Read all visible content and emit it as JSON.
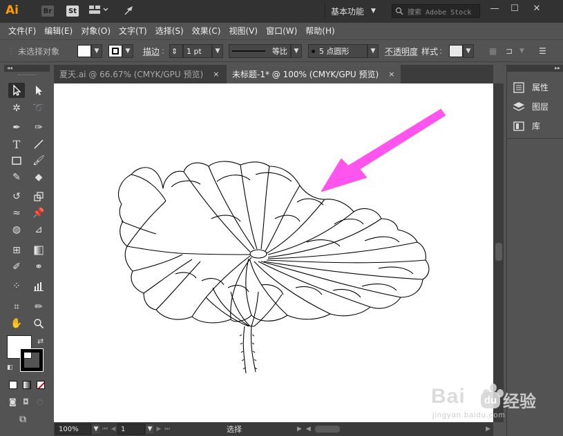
{
  "titlebar": {
    "logo": "Ai",
    "bridge_label": "Br",
    "stock_label": "St",
    "workspace": "基本功能",
    "search_placeholder": "搜索 Adobe Stock"
  },
  "menu": [
    "文件(F)",
    "编辑(E)",
    "对象(O)",
    "文字(T)",
    "选择(S)",
    "效果(C)",
    "视图(V)",
    "窗口(W)",
    "帮助(H)"
  ],
  "control": {
    "no_selection": "未选择对象",
    "stroke_label": "描边",
    "stroke_value": "1 pt",
    "stroke_profile": "等比",
    "brush_value": "5 点圆形",
    "opacity_label": "不透明度",
    "style_label": "样式"
  },
  "tabs": [
    {
      "label": "夏天.ai @ 66.67% (CMYK/GPU 预览)",
      "close": "×"
    },
    {
      "label": "未标题-1* @ 100% (CMYK/GPU 预览)",
      "close": "×"
    }
  ],
  "right_panel": {
    "items": [
      {
        "label": "属性",
        "icon": "properties-icon"
      },
      {
        "label": "图层",
        "icon": "layers-icon"
      },
      {
        "label": "库",
        "icon": "libraries-icon"
      }
    ]
  },
  "status": {
    "zoom": "100%",
    "page": "1",
    "tool": "选择"
  },
  "watermark": {
    "brand": "Bai",
    "brand2": "经验",
    "url": "jingyan.baidu.com"
  },
  "colors": {
    "arrow": "#ff55ee",
    "fill": "#ffffff",
    "stroke": "#000000",
    "logo": "#ff9a00"
  }
}
